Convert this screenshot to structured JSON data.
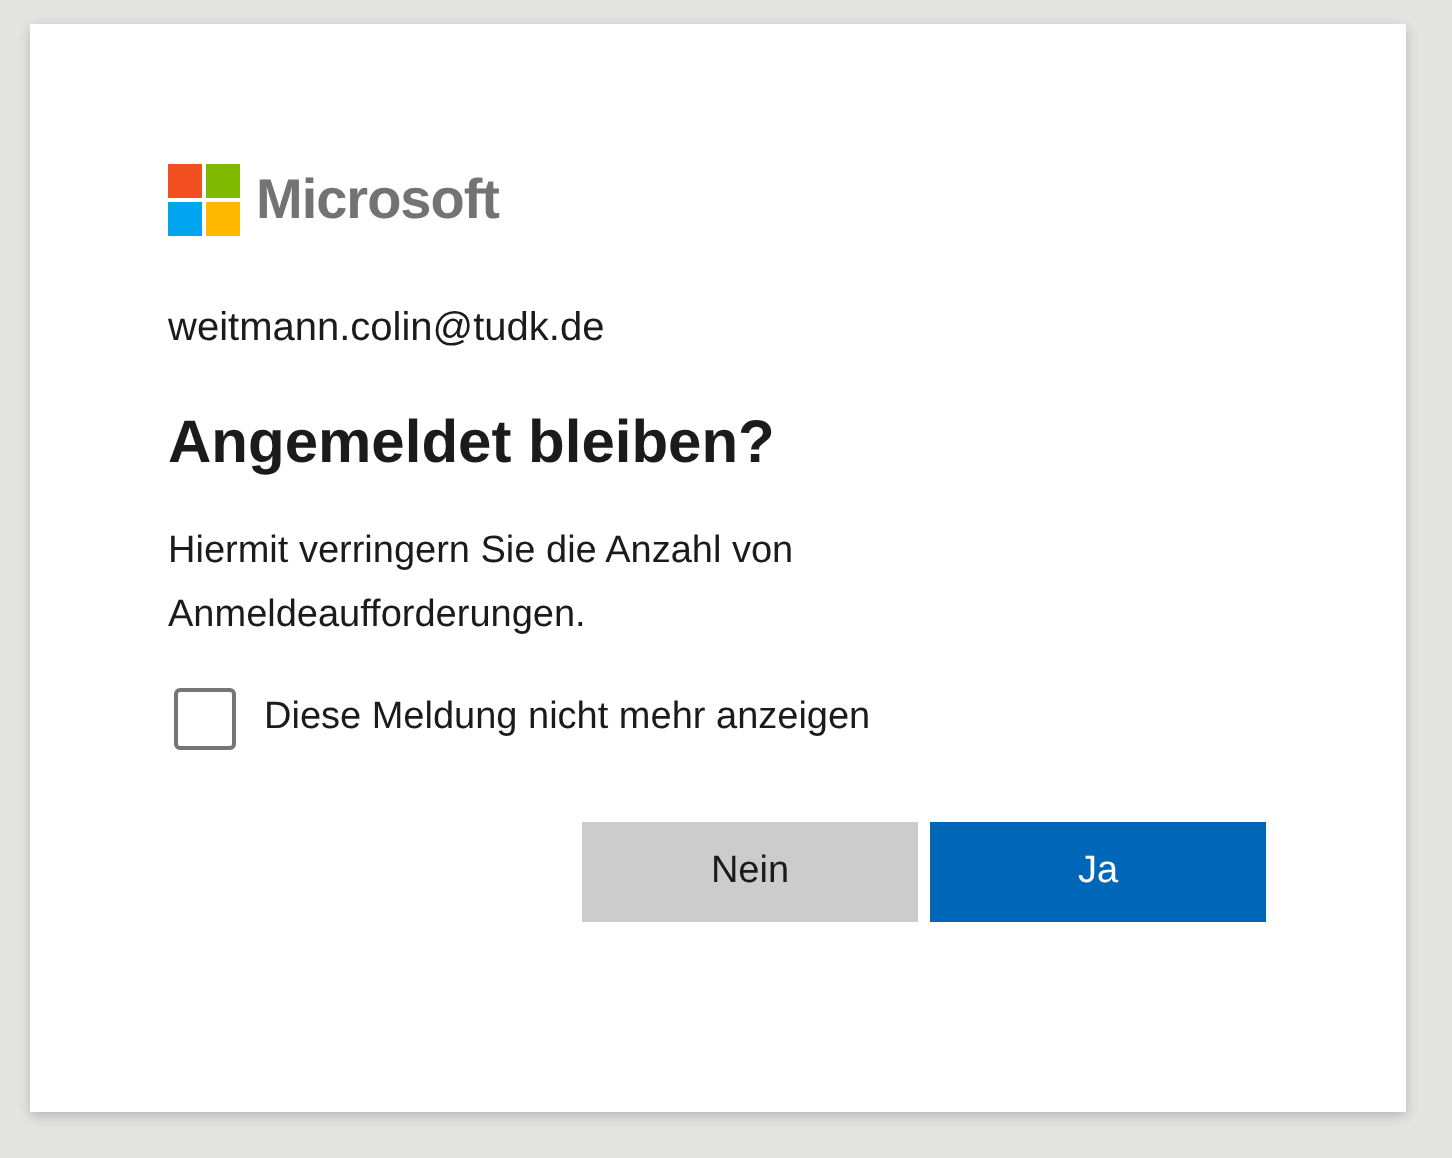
{
  "brand": {
    "name": "Microsoft"
  },
  "account": "weitmann.colin@tudk.de",
  "title": "Angemeldet bleiben?",
  "description": "Hiermit verringern Sie die Anzahl von Anmeldeaufforderungen.",
  "checkbox": {
    "label": "Diese Meldung nicht mehr anzeigen",
    "checked": false
  },
  "buttons": [
    {
      "label": "Nein",
      "kind": "secondary"
    },
    {
      "label": "Ja",
      "kind": "primary"
    }
  ]
}
